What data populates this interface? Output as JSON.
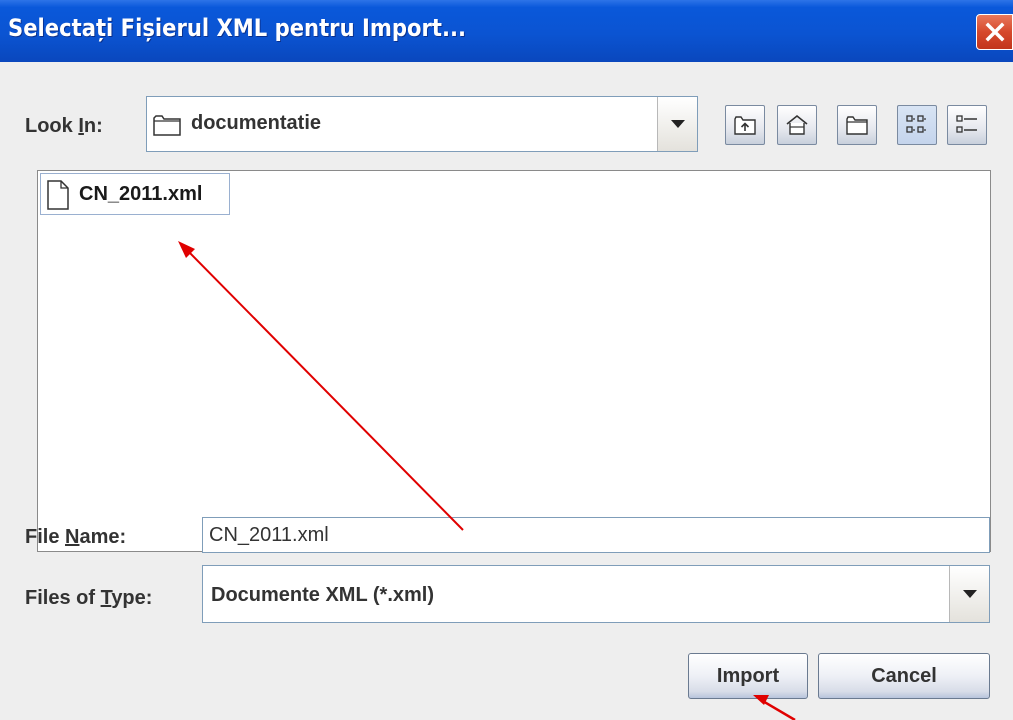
{
  "window": {
    "title": "Selectați Fișierul XML pentru Import..."
  },
  "look_in": {
    "label_prefix": "Look ",
    "label_mnemonic": "I",
    "label_suffix": "n:",
    "value": "documentatie"
  },
  "toolbar": {
    "icons": [
      "up-one-level-icon",
      "home-icon",
      "new-folder-icon",
      "list-view-icon",
      "details-view-icon"
    ]
  },
  "files": [
    {
      "name": "CN_2011.xml",
      "icon": "file-icon"
    }
  ],
  "file_name": {
    "label_prefix": "File ",
    "label_mnemonic": "N",
    "label_suffix": "ame:",
    "value": "CN_2011.xml"
  },
  "file_type": {
    "label_prefix": "Files of ",
    "label_mnemonic": "T",
    "label_suffix": "ype:",
    "value": "Documente XML (*.xml)"
  },
  "buttons": {
    "import_label": "Import",
    "cancel_label": "Cancel"
  },
  "colors": {
    "titlebar": "#0b54d2",
    "close_button": "#d6492c",
    "annotation_arrows": "#e00000"
  }
}
